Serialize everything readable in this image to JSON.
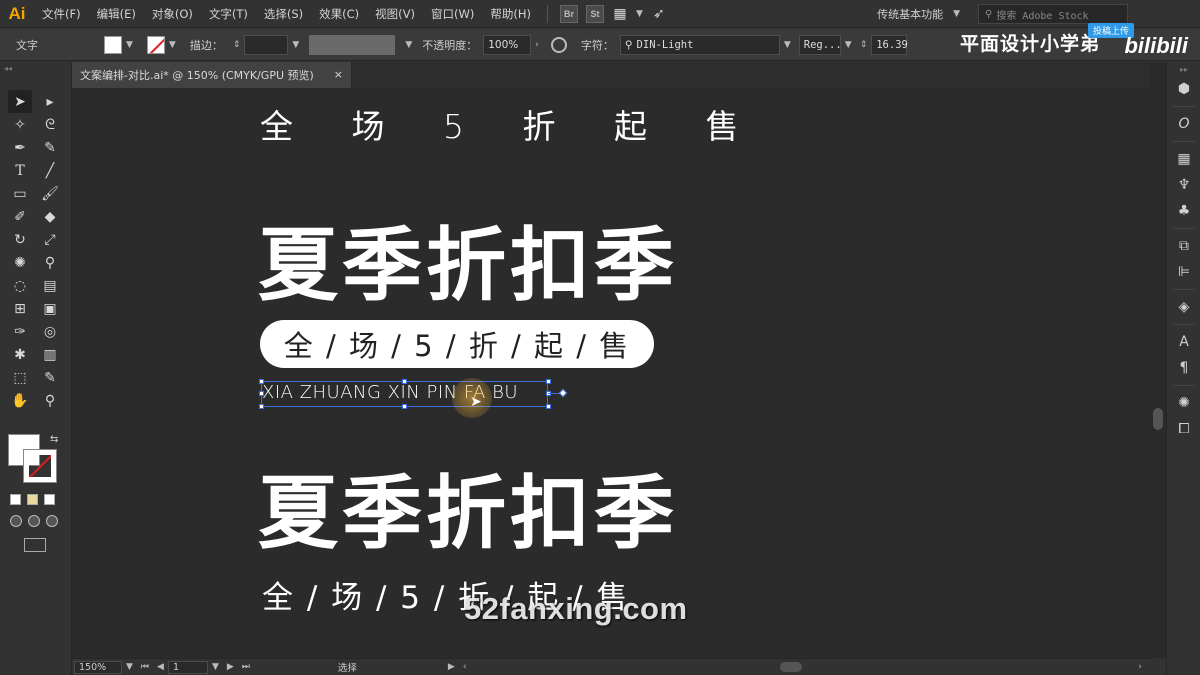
{
  "menubar": {
    "logo": "Ai",
    "items": [
      "文件(F)",
      "编辑(E)",
      "对象(O)",
      "文字(T)",
      "选择(S)",
      "效果(C)",
      "视图(V)",
      "窗口(W)",
      "帮助(H)"
    ],
    "btn_br": "Br",
    "btn_st": "St",
    "workspace": "传统基本功能",
    "search_placeholder": "搜索 Adobe Stock"
  },
  "controlbar": {
    "tool_name": "文字",
    "stroke_label": "描边：",
    "opacity_label": "不透明度：",
    "opacity_value": "100%",
    "char_label": "字符：",
    "font_name": "DIN-Light",
    "font_style": "Reg...",
    "font_size": "16.39",
    "overlay_title": "平面设计小学弟",
    "upload_tag": "投稿上传",
    "site_logo": "bilibili"
  },
  "document": {
    "tab_title": "文案编排-对比.ai* @ 150% (CMYK/GPU 预览)",
    "close": "×"
  },
  "canvas": {
    "line_top": "全 场 5 折 起 售",
    "headline_1": "夏季折扣季",
    "pill_text": "全 / 场 / 5 / 折 / 起 / 售",
    "pinyin": "XIA ZHUANG XIN PIN FA BU",
    "headline_2": "夏季折扣季",
    "line_bottom": "全 / 场 / 5 / 折 / 起 / 售",
    "watermark": "52fanxing.com"
  },
  "statusbar": {
    "zoom": "150%",
    "artboard": "1",
    "tool_status": "选择"
  },
  "colors": {
    "accent_ai": "#f7a400",
    "selection": "#3d6fe0",
    "bg": "#323232"
  }
}
